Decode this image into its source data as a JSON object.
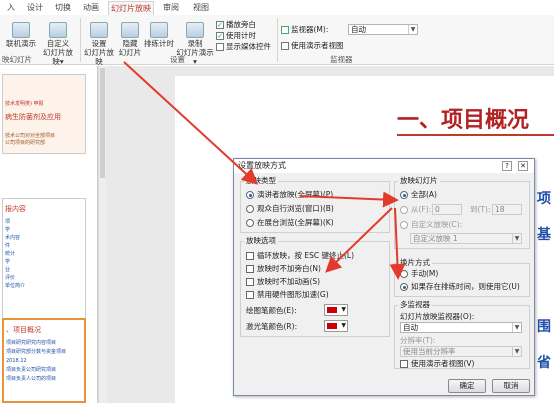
{
  "ribbon": {
    "tabs": [
      "入",
      "设计",
      "切换",
      "动画",
      "幻灯片放映",
      "审阅",
      "视图"
    ],
    "active_tab": "幻灯片放映",
    "buttons": [
      {
        "l1": "联机演示",
        "l2": ""
      },
      {
        "l1": "自定义",
        "l2": "幻灯片放映▾"
      },
      {
        "l1": "设置",
        "l2": "幻灯片放映"
      },
      {
        "l1": "隐藏",
        "l2": "幻灯片"
      },
      {
        "l1": "排练计时",
        "l2": ""
      },
      {
        "l1": "录制",
        "l2": "幻灯片演示▾"
      }
    ],
    "checks": [
      {
        "label": "播放旁白",
        "checked": true
      },
      {
        "label": "使用计时",
        "checked": true
      },
      {
        "label": "显示媒体控件",
        "checked": false
      }
    ],
    "monitor_label": "监视器(M):",
    "monitor_value": "自动",
    "presenter_view": "使用演示者视图",
    "groups": [
      "映幻灯片",
      "设置",
      "监视器"
    ]
  },
  "thumbs": {
    "t1": [
      "技术发明类) 申报",
      "病生防菌剂及应用",
      "技术公司对对全部项目",
      "公司项目的研究部"
    ],
    "t2": [
      "报内容",
      "项",
      "学",
      "术内容",
      "件",
      "统计",
      "学",
      "业",
      "评价",
      "单位简介"
    ],
    "t3": [
      "、项目概况",
      "项目研究研究内容项目",
      "项目研究部分数与资金项目",
      "2018.12",
      "项目负责公司研究项目",
      "项目负责人公司的项目"
    ]
  },
  "slide": {
    "title": "一、项目概况",
    "side_chars": [
      "项",
      "基",
      "围",
      "省"
    ]
  },
  "dialog": {
    "title": "设置放映方式",
    "show_type": {
      "legend": "放映类型",
      "options": [
        {
          "label": "演讲者放映(全屏幕)(P)",
          "selected": true
        },
        {
          "label": "观众自行浏览(窗口)(B)",
          "selected": false
        },
        {
          "label": "在展台浏览(全屏幕)(K)",
          "selected": false
        }
      ]
    },
    "show_options": {
      "legend": "放映选项",
      "checks": [
        "循环放映，按 ESC 键终止(L)",
        "放映时不加旁白(N)",
        "放映时不加动画(S)",
        "禁用硬件图形加速(G)"
      ],
      "pen_label": "绘图笔颜色(E):",
      "laser_label": "激光笔颜色(R):"
    },
    "show_slides": {
      "legend": "放映幻灯片",
      "all": "全部(A)",
      "from": "从(F):",
      "from_value": "0",
      "to": "到(T):",
      "to_value": "18",
      "custom": "自定义放映(C):",
      "custom_value": "自定义放映 1"
    },
    "advance": {
      "legend": "换片方式",
      "manual": "手动(M)",
      "timings": "如果存在排练时间，则使用它(U)"
    },
    "monitors": {
      "legend": "多监视器",
      "monitor_label": "幻灯片放映监视器(O):",
      "monitor_value": "自动",
      "resolution_label": "分辨率(T):",
      "resolution_value": "使用当前分辨率",
      "presenter_view": "使用演示者视图(V)"
    },
    "ok": "确定",
    "cancel": "取消"
  },
  "colors": {
    "accent": "#c0392b",
    "arrow": "#e23b2e",
    "slide_title": "#b22222",
    "slide_blue": "#1f4fa8",
    "pen": "#cc0000"
  }
}
